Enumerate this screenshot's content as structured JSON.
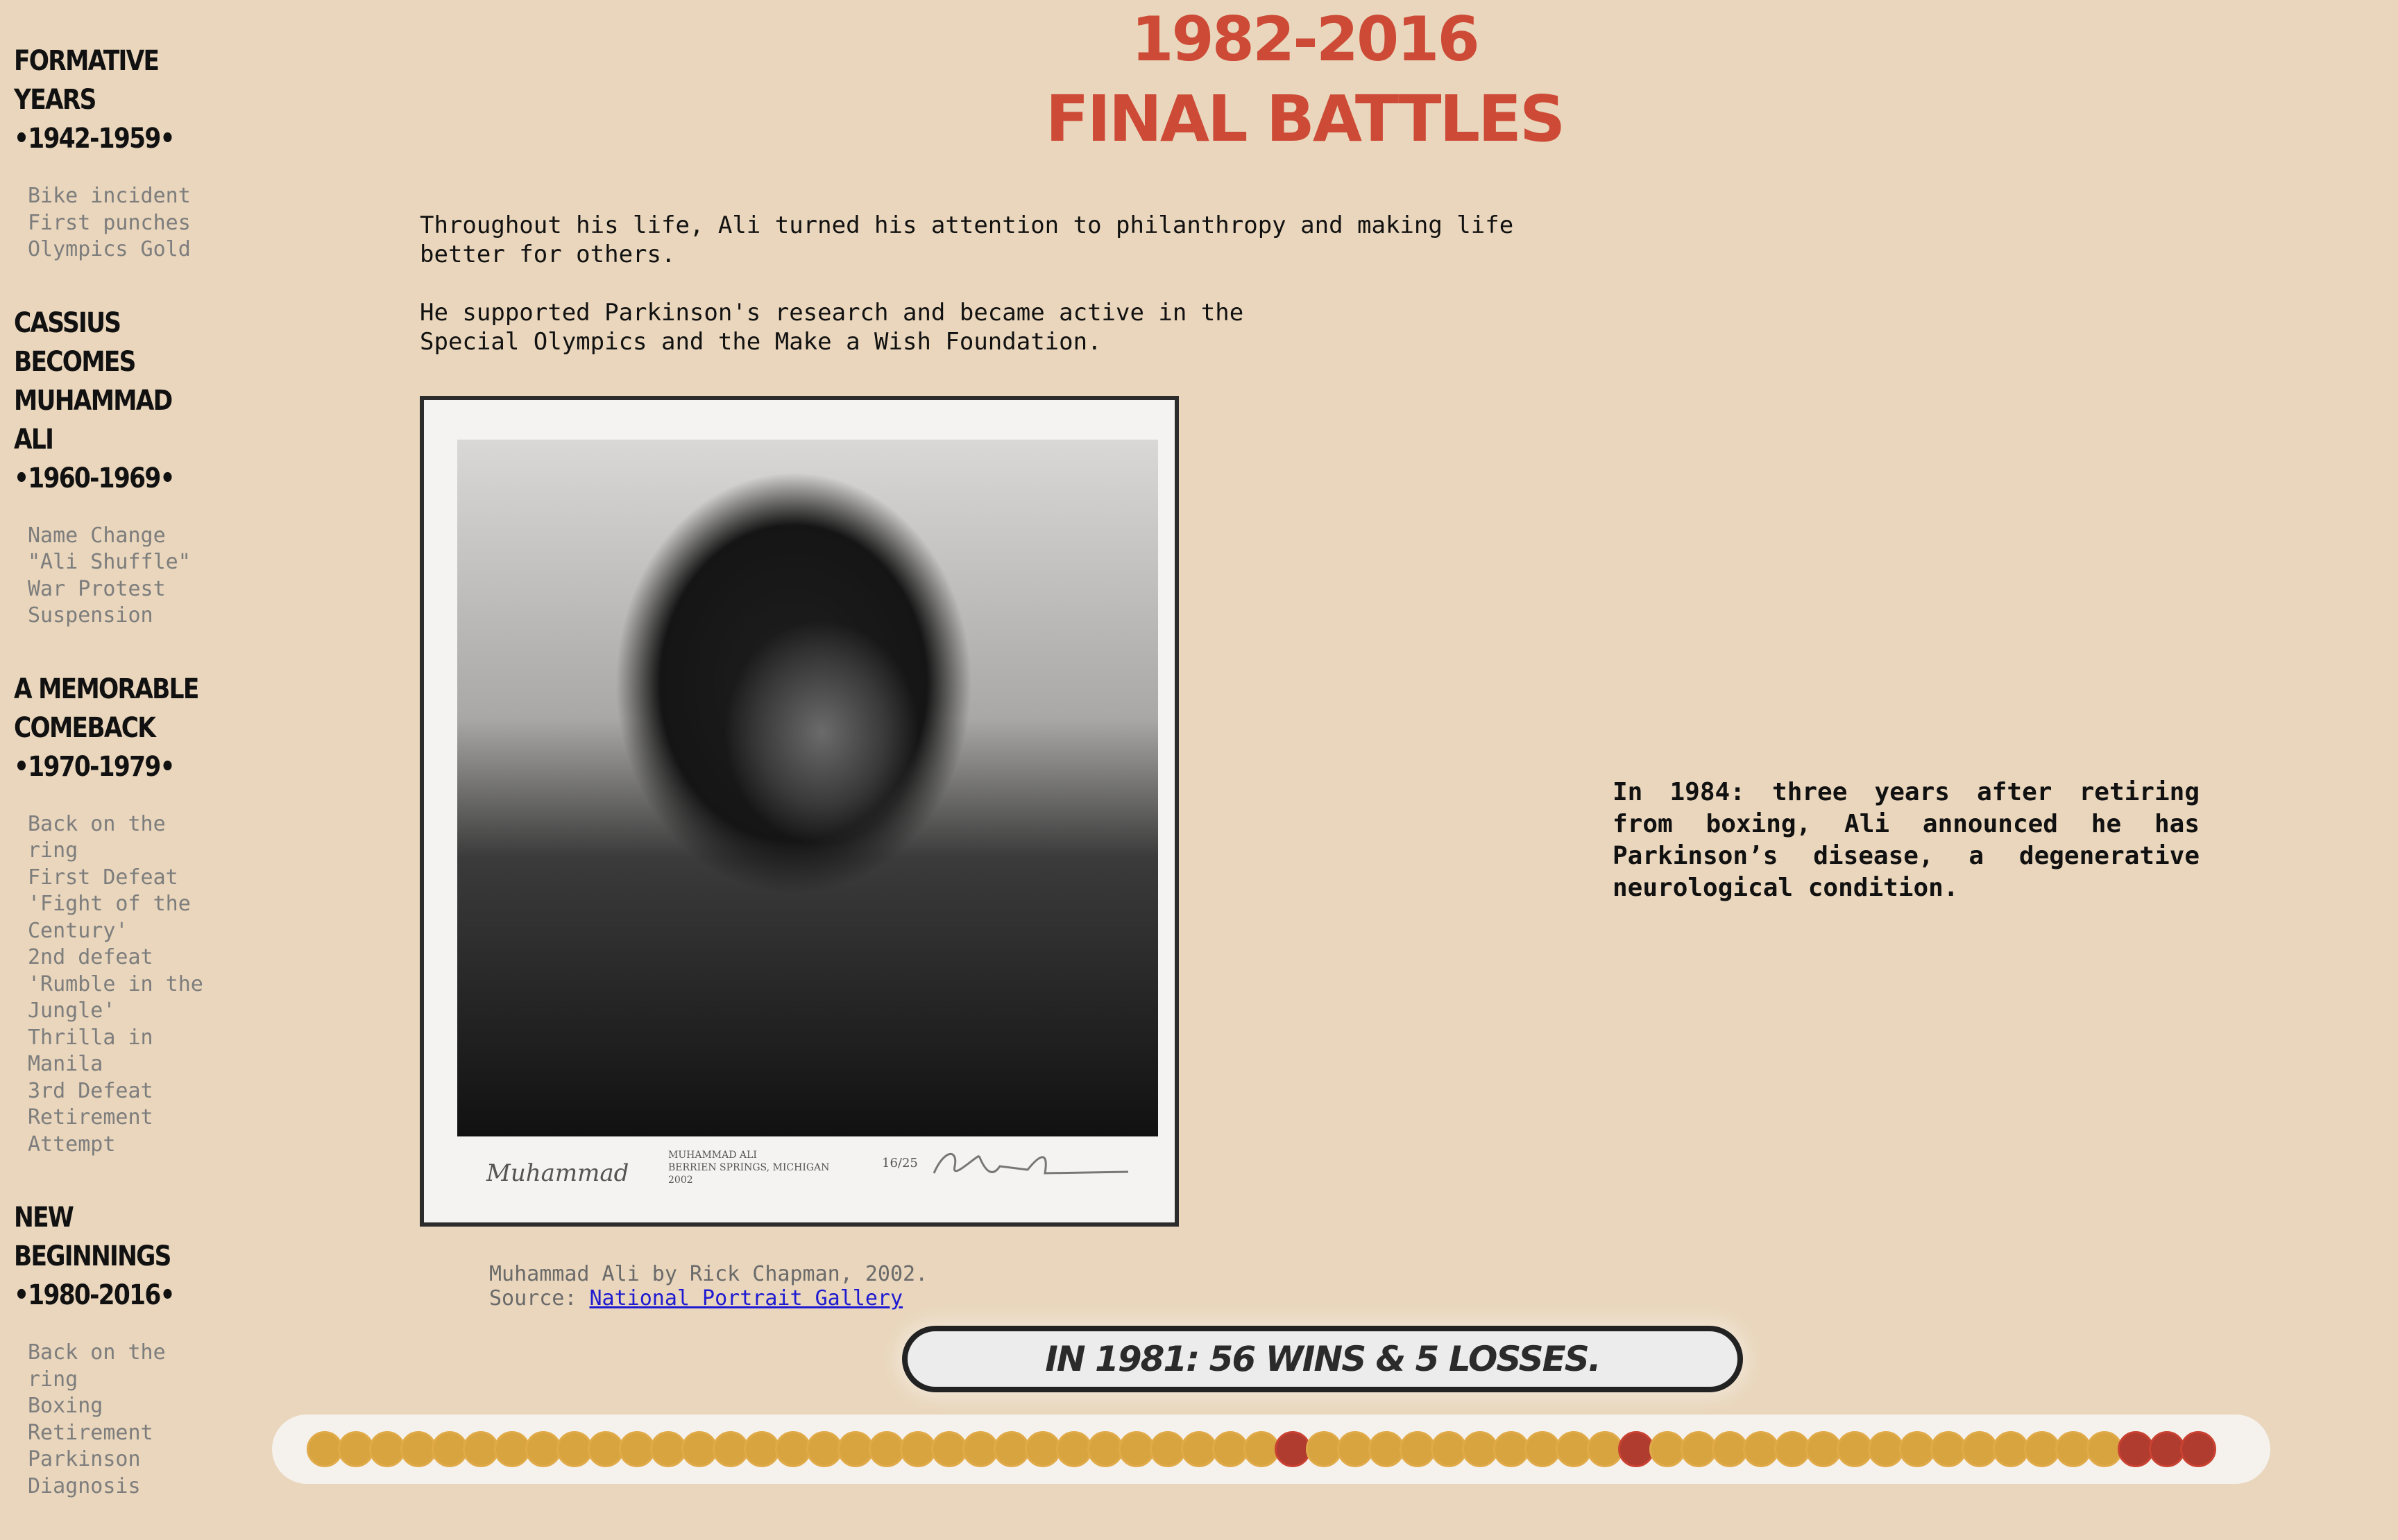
{
  "header": {
    "years": "1982-2016",
    "title": "FINAL BATTLES"
  },
  "sidebar": {
    "eras": [
      {
        "title_lines": [
          "FORMATIVE YEARS",
          "•1942-1959•"
        ],
        "links": [
          "Bike incident",
          "First punches",
          "Olympics Gold"
        ]
      },
      {
        "title_lines": [
          "CASSIUS BECOMES",
          "MUHAMMAD ALI",
          "•1960-1969•"
        ],
        "links": [
          "Name Change",
          "\"Ali Shuffle\"",
          "War Protest",
          "Suspension"
        ]
      },
      {
        "title_lines": [
          "A MEMORABLE",
          "COMEBACK",
          "•1970-1979•"
        ],
        "links": [
          "Back on the ring",
          "First Defeat",
          "'Fight of the Century'",
          "2nd defeat",
          "'Rumble in the Jungle'",
          "Thrilla in Manila",
          "3rd Defeat",
          "Retirement Attempt"
        ]
      },
      {
        "title_lines": [
          "NEW BEGINNINGS",
          "•1980-2016•"
        ],
        "links": [
          "Back on the ring",
          "Boxing Retirement",
          "Parkinson Diagnosis"
        ]
      }
    ]
  },
  "content": {
    "paragraph_1": "Throughout his life, Ali turned his attention to philanthropy and making life better for others.",
    "paragraph_2": "He supported Parkinson's research and became active in the Special Olympics and the Make a Wish Foundation.",
    "photo_signature": "Muhammad",
    "photo_inscription": "MUHAMMAD ALI\nBERRIEN SPRINGS, MICHIGAN\n2002",
    "photo_edition": "16/25",
    "caption_line": "Muhammad Ali by Rick Chapman, 2002.",
    "caption_source_label": "Source:",
    "caption_source_link": "National Portrait Gallery",
    "side_note": "In 1984: three years after retiring from boxing, Ali announced he has Parkinson’s disease, a degenerative neurological condition."
  },
  "record": {
    "label": "IN 1981: 56 WINS & 5 LOSSES.",
    "wins": 56,
    "losses": 5,
    "fights": [
      "W",
      "W",
      "W",
      "W",
      "W",
      "W",
      "W",
      "W",
      "W",
      "W",
      "W",
      "W",
      "W",
      "W",
      "W",
      "W",
      "W",
      "W",
      "W",
      "W",
      "W",
      "W",
      "W",
      "W",
      "W",
      "W",
      "W",
      "W",
      "W",
      "W",
      "W",
      "L",
      "W",
      "W",
      "W",
      "W",
      "W",
      "W",
      "W",
      "W",
      "W",
      "W",
      "L",
      "W",
      "W",
      "W",
      "W",
      "W",
      "W",
      "W",
      "W",
      "W",
      "W",
      "W",
      "W",
      "W",
      "W",
      "W",
      "L",
      "L",
      "L"
    ]
  },
  "colors": {
    "background": "#e9d6bc",
    "heading": "#cd4a36",
    "win_dot": "#d8a440",
    "loss_dot": "#b03b2f"
  }
}
